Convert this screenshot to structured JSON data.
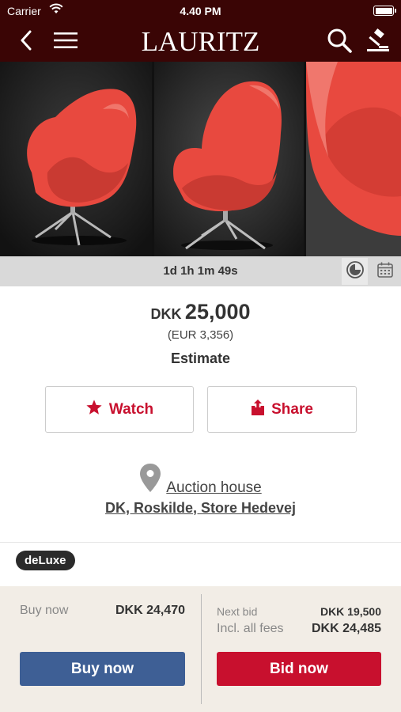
{
  "status_bar": {
    "carrier": "Carrier",
    "time": "4.40 PM"
  },
  "nav": {
    "logo": "LAURITZ",
    "back_icon": "chevron-left-icon",
    "menu_icon": "hamburger-menu-icon",
    "search_icon": "search-icon",
    "auction_icon": "gavel-icon"
  },
  "gallery": {
    "images": [
      "red egg chair front view",
      "red egg chair angled view",
      "red egg chair seat close-up"
    ]
  },
  "timer": {
    "countdown": "1d 1h 1m 49s",
    "clock_icon": "clock-icon",
    "calendar_icon": "calendar-icon"
  },
  "price": {
    "currency": "DKK",
    "amount": "25,000",
    "eur": "(EUR 3,356)",
    "label": "Estimate"
  },
  "actions": {
    "watch": "Watch",
    "share": "Share"
  },
  "location": {
    "link": "Auction house",
    "address": "DK, Roskilde, Store Hedevej"
  },
  "badge": "deLuxe",
  "buy": {
    "label": "Buy now",
    "value": "DKK 24,470",
    "button": "Buy now"
  },
  "bid": {
    "next_label": "Next bid",
    "next_value": "DKK 19,500",
    "fees_label": "Incl. all fees",
    "fees_value": "DKK 24,485",
    "button": "Bid now"
  },
  "colors": {
    "header": "#3a0505",
    "accent_red": "#c8102e",
    "buy_blue": "#3e5f95",
    "bottom_bg": "#f2ede6"
  }
}
